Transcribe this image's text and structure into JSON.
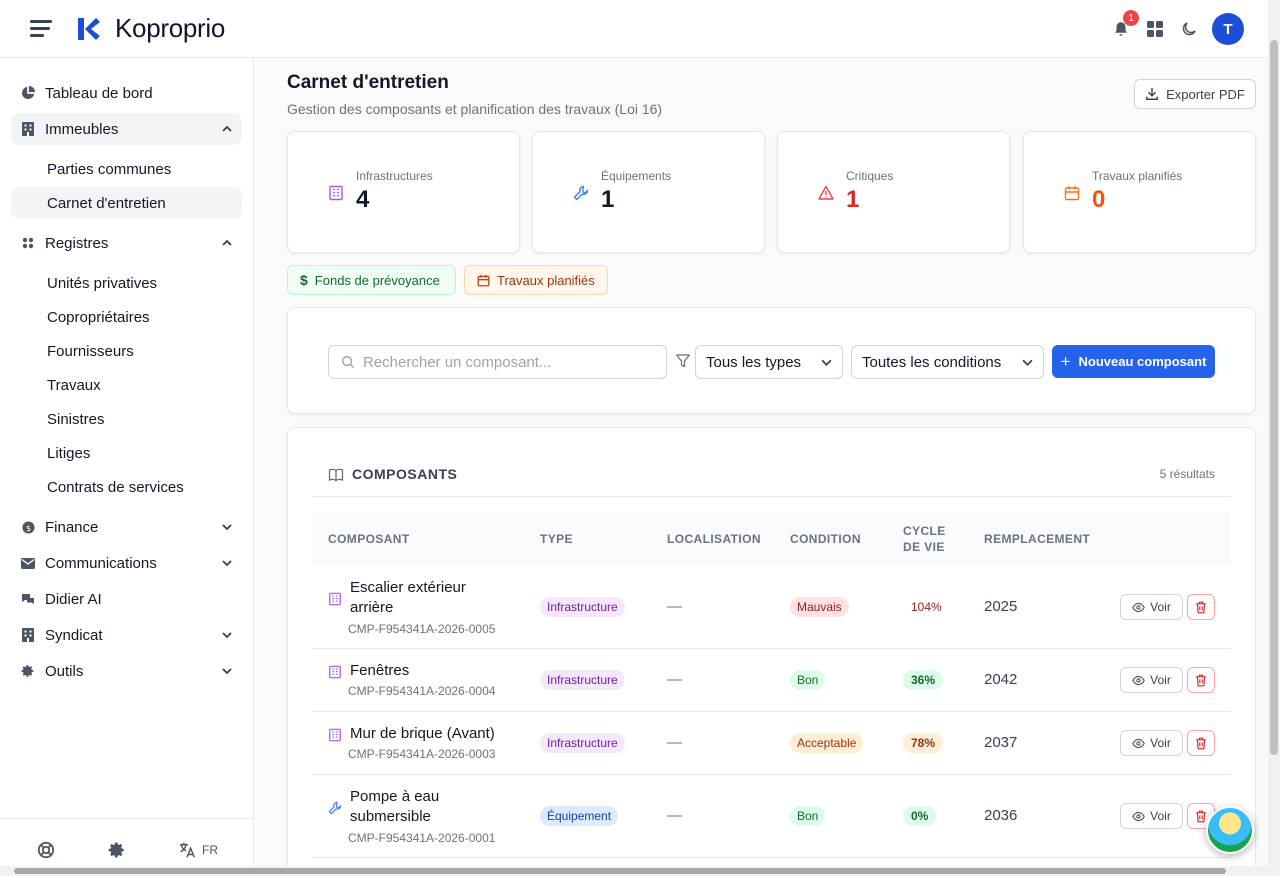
{
  "app": {
    "name": "Koproprio",
    "notification_count": "1",
    "user_initial": "T"
  },
  "sidebar": {
    "items": [
      {
        "label": "Tableau de bord",
        "icon": "pie-chart-icon"
      },
      {
        "label": "Immeubles",
        "icon": "building-icon",
        "expanded": true
      },
      {
        "label": "Registres",
        "icon": "grid-icon",
        "expanded": true
      },
      {
        "label": "Finance",
        "icon": "coin-icon"
      },
      {
        "label": "Communications",
        "icon": "mail-icon"
      },
      {
        "label": "Didier AI",
        "icon": "chat-icon"
      },
      {
        "label": "Syndicat",
        "icon": "building-icon"
      },
      {
        "label": "Outils",
        "icon": "gear-icon"
      }
    ],
    "immeubles_sub": [
      "Parties communes",
      "Carnet d'entretien"
    ],
    "registres_sub": [
      "Unités privatives",
      "Copropriétaires",
      "Fournisseurs",
      "Travaux",
      "Sinistres",
      "Litiges",
      "Contrats de services"
    ],
    "footer": {
      "language": "FR"
    }
  },
  "page": {
    "title": "Carnet d'entretien",
    "subtitle": "Gestion des composants et planification des travaux (Loi 16)",
    "export_label": "Exporter PDF"
  },
  "stats": [
    {
      "label": "Infrastructures",
      "value": "4",
      "color": "#111827",
      "icon_color": "#a855f7"
    },
    {
      "label": "Équipements",
      "value": "1",
      "color": "#111827",
      "icon_color": "#3b82f6"
    },
    {
      "label": "Critiques",
      "value": "1",
      "color": "#dc2626",
      "icon_color": "#ef4444"
    },
    {
      "label": "Travaux planifiés",
      "value": "0",
      "color": "#ea580c",
      "icon_color": "#f97316"
    }
  ],
  "chips": {
    "fonds": "Fonds de prévoyance",
    "travaux": "Travaux planifiés"
  },
  "filters": {
    "search_placeholder": "Rechercher un composant...",
    "type_select": "Tous les types",
    "condition_select": "Toutes les conditions",
    "new_button": "Nouveau composant"
  },
  "list": {
    "title": "COMPOSANTS",
    "count": "5 résultats",
    "columns": {
      "composant": "COMPOSANT",
      "type": "TYPE",
      "localisation": "LOCALISATION",
      "condition": "CONDITION",
      "cycle_1": "CYCLE",
      "cycle_2": "DE VIE",
      "remplacement": "REMPLACEMENT"
    },
    "view_label": "Voir",
    "rows": [
      {
        "name_1": "Escalier extérieur",
        "name_2": "arrière",
        "code": "CMP-F954341A-2026-0005",
        "type": "Infrastructure",
        "localisation": "—",
        "condition": "Mauvais",
        "cycle": "104%",
        "replacement": "2025"
      },
      {
        "name_1": "Fenêtres",
        "name_2": "",
        "code": "CMP-F954341A-2026-0004",
        "type": "Infrastructure",
        "localisation": "—",
        "condition": "Bon",
        "cycle": "36%",
        "replacement": "2042"
      },
      {
        "name_1": "Mur de brique (Avant)",
        "name_2": "",
        "code": "CMP-F954341A-2026-0003",
        "type": "Infrastructure",
        "localisation": "—",
        "condition": "Acceptable",
        "cycle": "78%",
        "replacement": "2037"
      },
      {
        "name_1": "Pompe à eau",
        "name_2": "submersible",
        "code": "CMP-F954341A-2026-0001",
        "type": "Équipement",
        "localisation": "—",
        "condition": "Bon",
        "cycle": "0%",
        "replacement": "2036"
      }
    ]
  }
}
